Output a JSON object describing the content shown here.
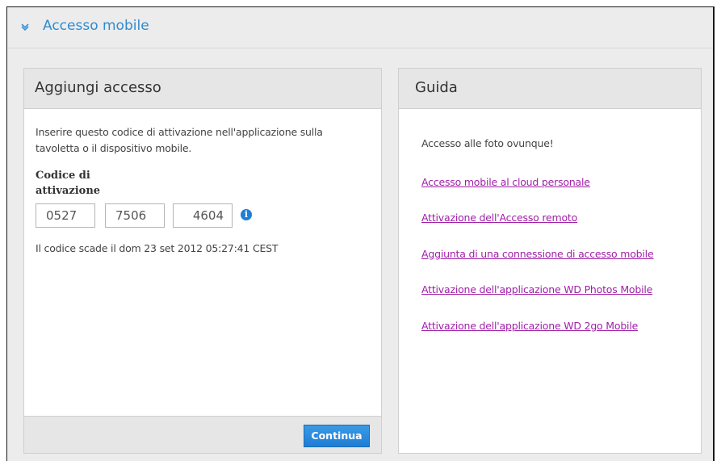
{
  "section": {
    "title": "Accesso mobile",
    "accent_color": "#2f8bd1"
  },
  "left_panel": {
    "title": "Aggiungi accesso",
    "instructions": "Inserire questo codice di attivazione nell'applicazione sulla tavoletta o il dispositivo mobile.",
    "code_label": "Codice di attivazione",
    "code_parts": [
      "0527",
      "7506",
      "4604"
    ],
    "info_icon": "info-icon",
    "expiry_text": "Il codice scade il dom 23 set 2012 05:27:41 CEST",
    "continue_label": "Continua",
    "button_color": "#1e7dd4"
  },
  "right_panel": {
    "title": "Guida",
    "intro": "Accesso alle foto ovunque!",
    "links": [
      "Accesso mobile al cloud personale",
      "Attivazione dell'Accesso remoto",
      "Aggiunta di una connessione di accesso mobile",
      "Attivazione dell'applicazione WD Photos Mobile",
      "Attivazione dell'applicazione WD 2go Mobile"
    ],
    "link_color": "#a01fa8"
  }
}
